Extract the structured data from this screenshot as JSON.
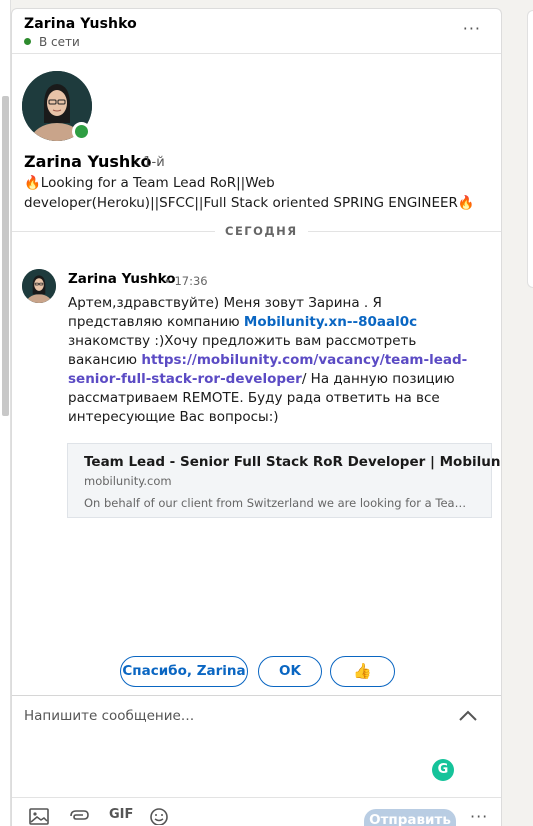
{
  "header": {
    "name": "Zarina Yushko",
    "status": "В сети",
    "more": "···"
  },
  "profile": {
    "name": "Zarina Yushko",
    "degree": "· 1-й",
    "headline": "🔥Looking for a Team Lead RoR||Web developer(Heroku)||SFCC||Full Stack oriented SPRING ENGINEER🔥"
  },
  "day_divider": "СЕГОДНЯ",
  "message": {
    "author": "Zarina Yushko",
    "time": "• 17:36",
    "text_1": "Артем,здравствуйте) Меня зовут Зарина . Я представляю компанию ",
    "link_company": "Mobilunity.xn--80aal0c",
    "text_2": " знакомству :)Хочу предложить вам рассмотреть вакансию ",
    "link_vacancy": "https://mobilunity.com/vacancy/team-lead-senior-full-stack-ror-developer",
    "text_3": "/ На данную позицию рассматриваем REMOTE. Буду рада ответить на все интересующие Вас вопросы:)"
  },
  "link_preview": {
    "title": "Team Lead - Senior Full Stack RoR Developer | Mobilunity",
    "domain": "mobilunity.com",
    "description": "On behalf of our client from Switzerland we are looking for a Team Le..."
  },
  "quick_replies": [
    "Спасибо, Zarina",
    "OK",
    "👍"
  ],
  "composer": {
    "placeholder": "Напишите сообщение…",
    "grammarly": "G"
  },
  "toolbar": {
    "gif_label": "GIF",
    "send_label": "Отправить",
    "more": "···"
  },
  "colors": {
    "accent": "#0a66c2",
    "online": "#2e9e43",
    "send_disabled": "#b9cde3"
  }
}
